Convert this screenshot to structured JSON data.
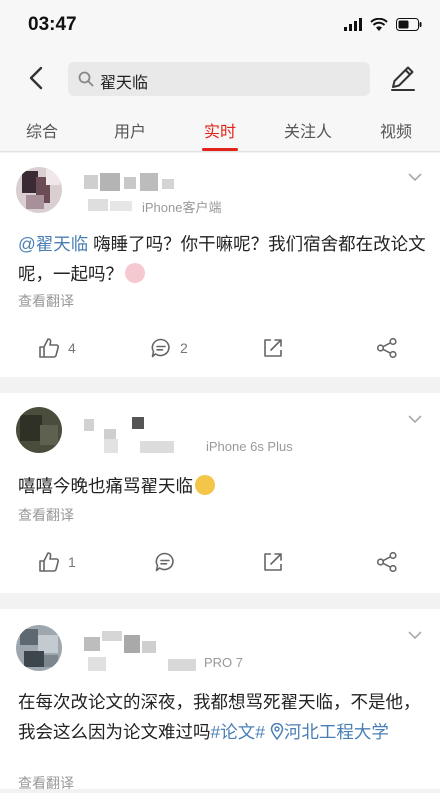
{
  "status": {
    "time": "03:47"
  },
  "search": {
    "query": "翟天临"
  },
  "tabs": [
    {
      "label": "综合"
    },
    {
      "label": "用户"
    },
    {
      "label": "实时"
    },
    {
      "label": "关注人"
    },
    {
      "label": "视频"
    }
  ],
  "posts": [
    {
      "source": "iPhone客户端",
      "mention": "@翟天临",
      "text": " 嗨睡了吗？你干嘛呢？我们宿舍都在改论文呢，一起吗？",
      "translate": "查看翻译",
      "likes": "4",
      "comments": "2"
    },
    {
      "source": "iPhone 6s Plus",
      "text": "嘻嘻今晚也痛骂翟天临",
      "translate": "查看翻译",
      "likes": "1"
    },
    {
      "source": "PRO 7",
      "text": "在每次改论文的深夜，我都想骂死翟天临，不是他，我会这么因为论文难过吗",
      "tag": "#论文#",
      "location": "河北工程大学",
      "translate": "查看翻译"
    }
  ]
}
